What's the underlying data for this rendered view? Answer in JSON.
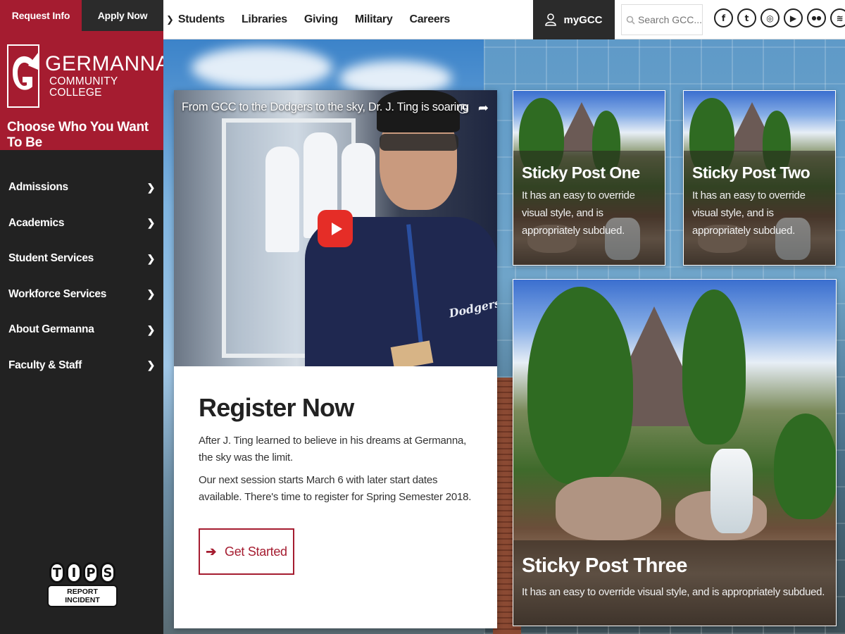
{
  "sidebar": {
    "request_info": "Request Info",
    "apply_now": "Apply Now",
    "logo_line1": "GERMANNA",
    "logo_line2": "COMMUNITY COLLEGE",
    "tagline": "Choose Who You Want To Be",
    "nav": [
      {
        "label": "Admissions"
      },
      {
        "label": "Academics"
      },
      {
        "label": "Student Services"
      },
      {
        "label": "Workforce Services"
      },
      {
        "label": "About Germanna"
      },
      {
        "label": "Faculty & Staff"
      }
    ],
    "tips_letters": [
      "T",
      "I",
      "P",
      "S"
    ],
    "tips_sub": "REPORT INCIDENT"
  },
  "topbar": {
    "nav": [
      "Students",
      "Libraries",
      "Giving",
      "Military",
      "Careers"
    ],
    "mygcc": "myGCC",
    "search_placeholder": "Search GCC...",
    "socials": [
      {
        "icon": "facebook-icon",
        "glyph": "f"
      },
      {
        "icon": "twitter-icon",
        "glyph": "t"
      },
      {
        "icon": "instagram-icon",
        "glyph": "◎"
      },
      {
        "icon": "youtube-icon",
        "glyph": "▶"
      },
      {
        "icon": "flickr-icon",
        "glyph": "●●"
      },
      {
        "icon": "rss-icon",
        "glyph": "≋"
      }
    ]
  },
  "feature": {
    "video_title": "From GCC to the Dodgers to the sky, Dr. J. Ting is soaring",
    "video_jersey_text": "Dodgers",
    "title": "Register Now",
    "p1": "After J. Ting learned to believe in his dreams at Germanna, the sky was the limit.",
    "p2": "Our next session starts March 6 with later start dates available. There's time to register for Spring Semester 2018.",
    "cta": "Get Started"
  },
  "posts": [
    {
      "title": "Sticky Post One",
      "desc": "It has an easy to override visual style, and is appropriately subdued."
    },
    {
      "title": "Sticky Post Two",
      "desc": "It has an easy to override visual style, and is appropriately subdued."
    },
    {
      "title": "Sticky Post Three",
      "desc": "It has an easy to override visual style, and is appropriately subdued."
    }
  ],
  "colors": {
    "brand": "#a51c30",
    "sidebar": "#222222",
    "dark_button": "#2b2b2b"
  }
}
